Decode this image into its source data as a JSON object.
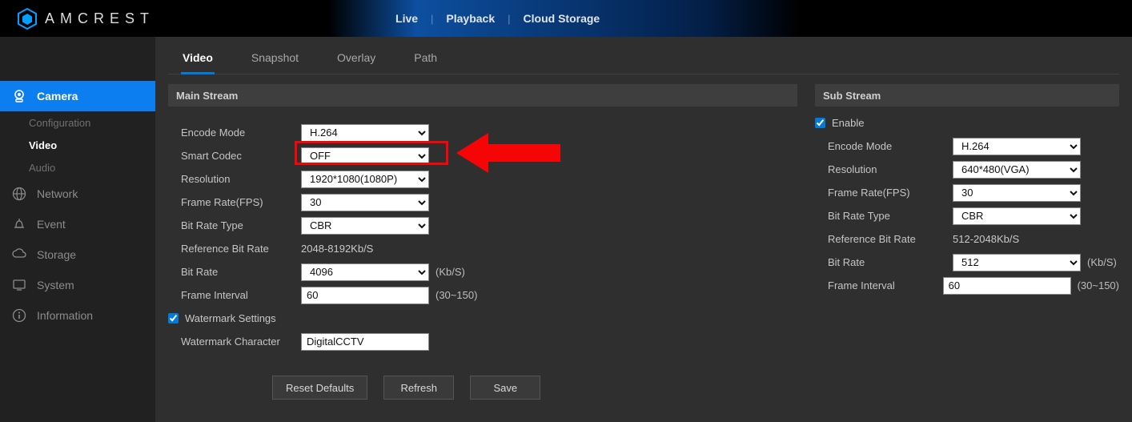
{
  "brand": "AMCREST",
  "top_nav": {
    "live": "Live",
    "playback": "Playback",
    "cloud": "Cloud Storage"
  },
  "sidebar": {
    "camera": "Camera",
    "camera_sub": {
      "configuration": "Configuration",
      "video": "Video",
      "audio": "Audio"
    },
    "network": "Network",
    "event": "Event",
    "storage": "Storage",
    "system": "System",
    "information": "Information"
  },
  "tabs": {
    "video": "Video",
    "snapshot": "Snapshot",
    "overlay": "Overlay",
    "path": "Path"
  },
  "main": {
    "header": "Main Stream",
    "labels": {
      "encode": "Encode Mode",
      "smart": "Smart Codec",
      "resolution": "Resolution",
      "fps": "Frame Rate(FPS)",
      "brtype": "Bit Rate Type",
      "refbr": "Reference Bit Rate",
      "bitrate": "Bit Rate",
      "finterval": "Frame Interval",
      "watermark": "Watermark Settings",
      "wmchar": "Watermark Character"
    },
    "values": {
      "encode": "H.264",
      "smart": "OFF",
      "resolution": "1920*1080(1080P)",
      "fps": "30",
      "brtype": "CBR",
      "refbr": "2048-8192Kb/S",
      "bitrate": "4096",
      "bitrate_suffix": "(Kb/S)",
      "finterval": "60",
      "finterval_suffix": "(30~150)",
      "wmchar": "DigitalCCTV"
    }
  },
  "sub": {
    "header": "Sub Stream",
    "enable_label": "Enable",
    "labels": {
      "encode": "Encode Mode",
      "resolution": "Resolution",
      "fps": "Frame Rate(FPS)",
      "brtype": "Bit Rate Type",
      "refbr": "Reference Bit Rate",
      "bitrate": "Bit Rate",
      "finterval": "Frame Interval"
    },
    "values": {
      "encode": "H.264",
      "resolution": "640*480(VGA)",
      "fps": "30",
      "brtype": "CBR",
      "refbr": "512-2048Kb/S",
      "bitrate": "512",
      "bitrate_suffix": "(Kb/S)",
      "finterval": "60",
      "finterval_suffix": "(30~150)"
    }
  },
  "buttons": {
    "reset": "Reset Defaults",
    "refresh": "Refresh",
    "save": "Save"
  }
}
